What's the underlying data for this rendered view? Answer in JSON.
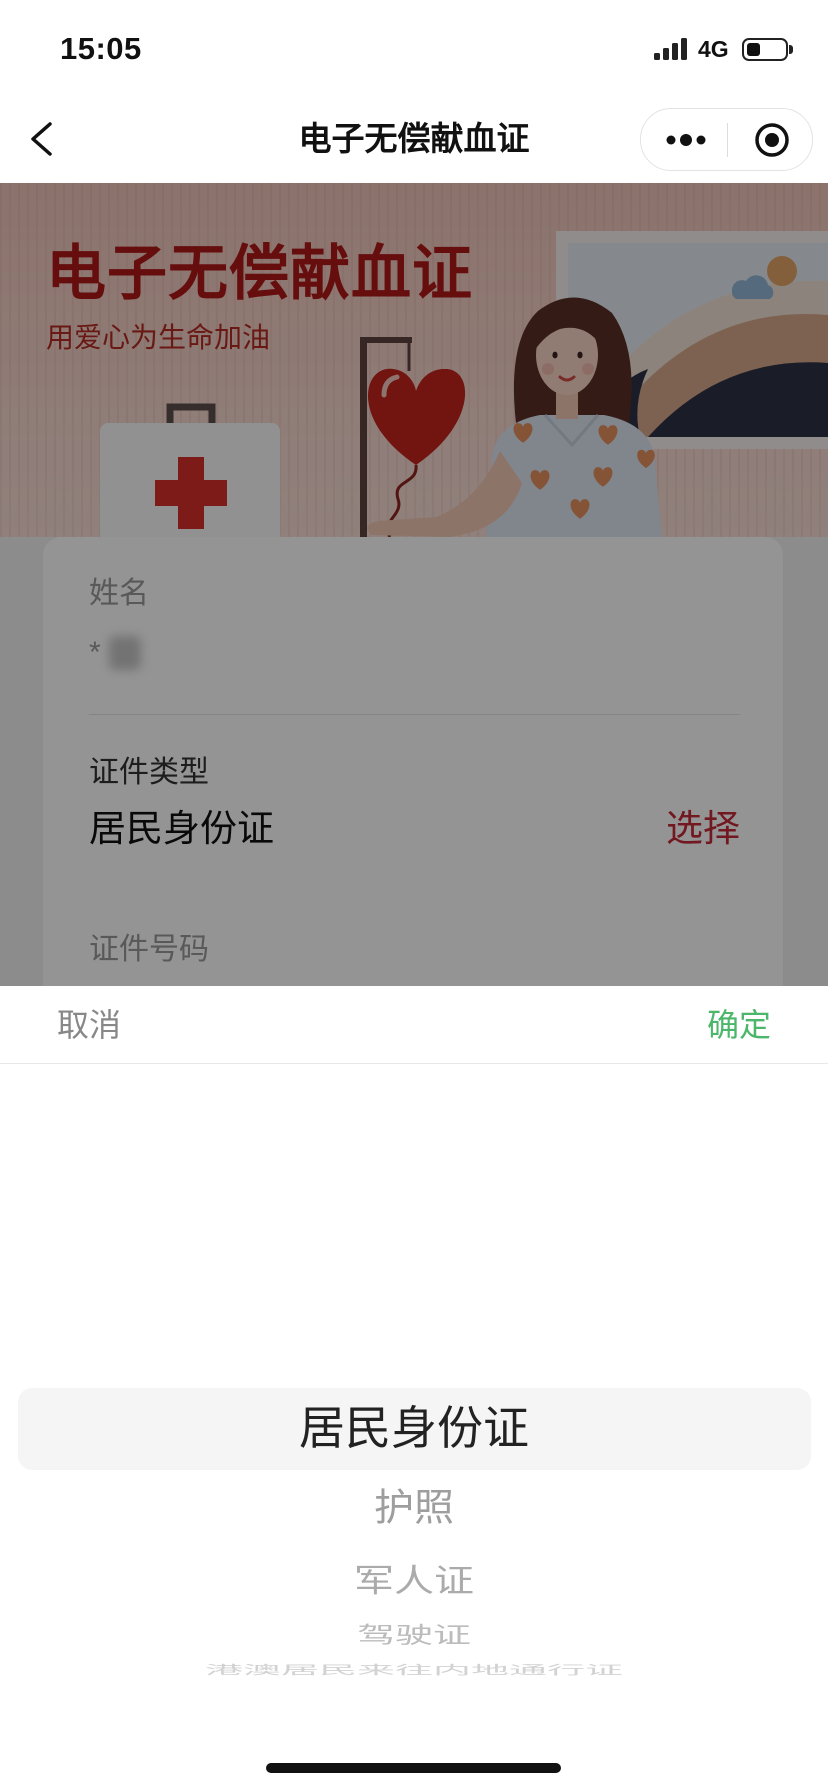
{
  "status_bar": {
    "time": "15:05",
    "network": "4G",
    "signal_bars": 4,
    "battery_level": 0.35
  },
  "nav_bar": {
    "title": "电子无偿献血证",
    "icons": {
      "back": "chevron-left-icon",
      "more": "more-dots-icon",
      "close": "target-circle-icon"
    }
  },
  "banner": {
    "title": "电子无偿献血证",
    "subtitle": "用爱心为生命加油"
  },
  "form": {
    "name": {
      "label": "姓名",
      "value": "*"
    },
    "id_type": {
      "label": "证件类型",
      "value": "居民身份证",
      "action": "选择"
    },
    "id_number": {
      "label": "证件号码"
    }
  },
  "picker": {
    "cancel": "取消",
    "confirm": "确定",
    "options": [
      "居民身份证",
      "护照",
      "军人证",
      "驾驶证",
      "港澳居民来往内地通行证"
    ],
    "selected_index": 0
  },
  "colors": {
    "banner_title": "#b01818",
    "action_red": "#c42a38",
    "confirm_green": "#4cb66b",
    "mask": "rgba(0,0,0,0.42)"
  }
}
